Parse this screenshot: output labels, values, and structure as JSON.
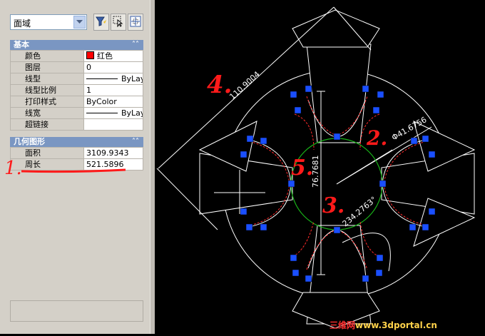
{
  "palette": {
    "object_type": "面域",
    "tool_icons": [
      "quick-select-icon",
      "select-objects-icon",
      "pickadd-toggle-icon"
    ],
    "sections": {
      "basic": {
        "title": "基本",
        "rows": [
          {
            "label": "颜色",
            "value": "红色"
          },
          {
            "label": "图层",
            "value": "0"
          },
          {
            "label": "线型",
            "value": "ByLayer"
          },
          {
            "label": "线型比例",
            "value": "1"
          },
          {
            "label": "打印样式",
            "value": "ByColor"
          },
          {
            "label": "线宽",
            "value": "ByLayer"
          },
          {
            "label": "超链接",
            "value": ""
          }
        ]
      },
      "geometry": {
        "title": "几何图形",
        "rows": [
          {
            "label": "面积",
            "value": "3109.9343"
          },
          {
            "label": "周长",
            "value": "521.5896"
          }
        ]
      }
    },
    "color_swatch": "#ff0000"
  },
  "drawing": {
    "dims": {
      "aligned": "110.9004",
      "vertical": "76.7681",
      "diameter": "Φ41.6756",
      "angle": "234.2763°"
    },
    "annotations": [
      "1.",
      "2.",
      "3.",
      "4.",
      "5."
    ],
    "colors": {
      "background": "#000000",
      "lines": "#ffffff",
      "circle": "#19b619",
      "dashed": "#ff2a2a",
      "grips": "#1a4fff",
      "markup": "#ff1a1a"
    }
  },
  "watermark": {
    "part1": "三维网",
    "part2": "www.3dportal.cn"
  }
}
